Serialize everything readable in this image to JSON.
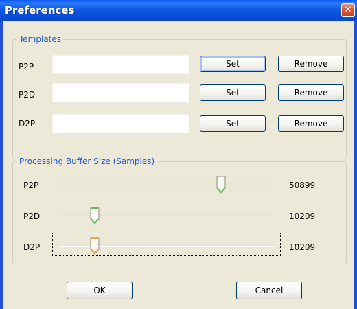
{
  "window": {
    "title": "Preferences",
    "close_glyph": "✕"
  },
  "templates": {
    "group_title": "Templates",
    "rows": [
      {
        "label": "P2P",
        "value": "",
        "set_label": "Set",
        "remove_label": "Remove"
      },
      {
        "label": "P2D",
        "value": "",
        "set_label": "Set",
        "remove_label": "Remove"
      },
      {
        "label": "D2P",
        "value": "",
        "set_label": "Set",
        "remove_label": "Remove"
      }
    ]
  },
  "buffer": {
    "group_title": "Processing Buffer Size (Samples)",
    "sliders": [
      {
        "label": "P2P",
        "value": "50899",
        "thumb_color": "#5bc24c"
      },
      {
        "label": "P2D",
        "value": "10209",
        "thumb_color": "#5bc24c"
      },
      {
        "label": "D2P",
        "value": "10209",
        "thumb_color": "#f0a030"
      }
    ]
  },
  "footer": {
    "ok_label": "OK",
    "cancel_label": "Cancel"
  },
  "colors": {
    "titlebar": "#0a58f2",
    "group_title": "#1f55d8",
    "dialog_bg": "#ece9d8"
  }
}
